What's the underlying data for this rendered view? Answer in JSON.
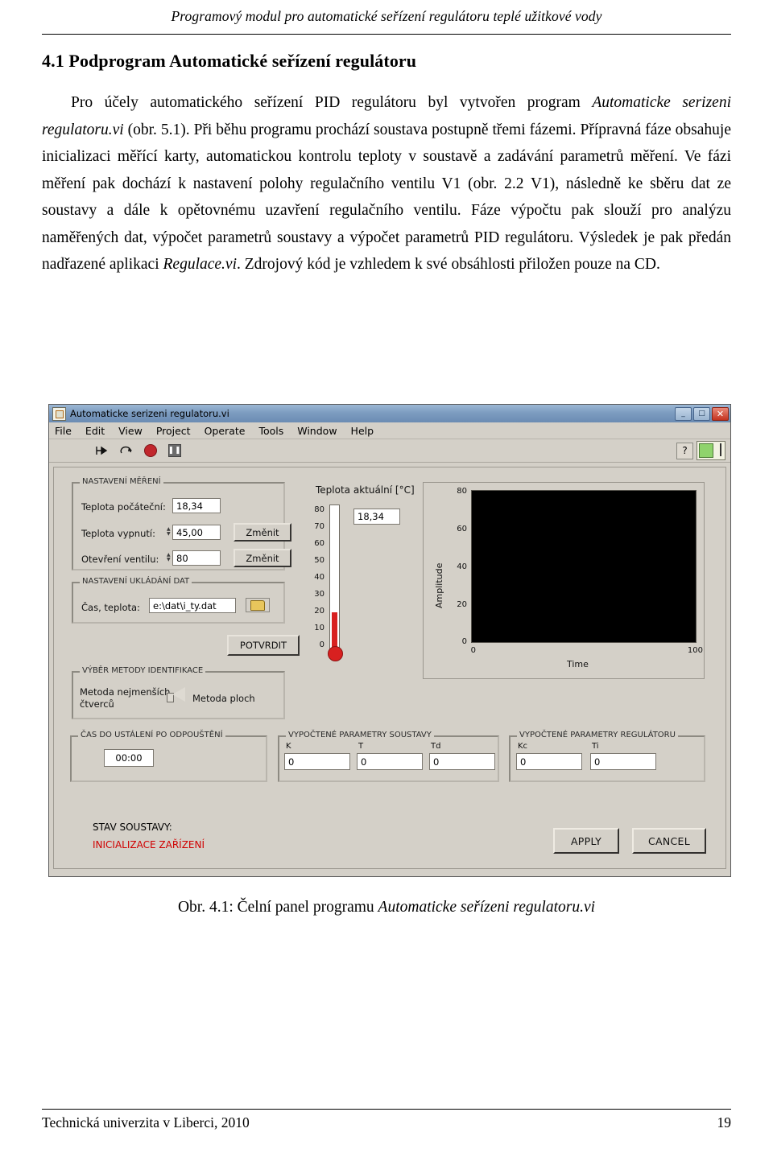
{
  "header": {
    "running_head": "Programový modul pro automatické seřízení regulátoru teplé užitkové vody"
  },
  "footer": {
    "left": "Technická univerzita v Liberci, 2010",
    "page_number": "19"
  },
  "section": {
    "title": "4.1 Podprogram Automatické seřízení regulátoru",
    "paragraph": {
      "p1": "Pro účely automatického seřízení PID regulátoru byl vytvořen program ",
      "i1": "Automaticke serizeni regulatoru.vi",
      "p2": " (obr. 5.1). Při běhu programu prochází soustava postupně třemi fázemi. Přípravná fáze obsahuje inicializaci měřící karty, automatickou kontrolu teploty v soustavě a zadávání parametrů měření. Ve fázi měření pak dochází k nastavení polohy regulačního ventilu V1 (obr. 2.2 V1), následně ke sběru dat ze soustavy a dále k opětovnému uzavření regulačního ventilu. Fáze výpočtu pak slouží pro analýzu naměřených dat, výpočet parametrů soustavy a výpočet parametrů PID regulátoru. Výsledek je pak předán nadřazené aplikaci ",
      "i2": "Regulace.vi",
      "p3": ". Zdrojový kód je vzhledem k své obsáhlosti přiložen pouze na CD."
    }
  },
  "figure": {
    "caption_prefix": "Obr. 4.1: Čelní panel programu ",
    "caption_italic": "Automaticke seřízeni regulatoru.vi"
  },
  "vi": {
    "title": "Automaticke serizeni regulatoru.vi",
    "window_buttons": {
      "minimize": "_",
      "maximize": "□",
      "close": "✕"
    },
    "menu": [
      "File",
      "Edit",
      "View",
      "Project",
      "Operate",
      "Tools",
      "Window",
      "Help"
    ],
    "toolbar": {
      "run_icon": "run-arrow-icon",
      "run_continuous_icon": "run-continuous-icon",
      "abort_icon": "abort-button-icon",
      "pause_icon": "pause-button-icon",
      "help_icon": "?",
      "pause_glyph": "❚❚"
    },
    "measurement_group": {
      "label": "NASTAVENÍ MĚŘENÍ",
      "rows": [
        {
          "label": "Teplota počáteční:",
          "value": "18,34",
          "button": null
        },
        {
          "label": "Teplota vypnutí:",
          "value": "45,00",
          "button": "Změnit"
        },
        {
          "label": "Otevření ventilu:",
          "value": "80",
          "button": "Změnit"
        }
      ]
    },
    "storage_group": {
      "label": "NASTAVENÍ UKLÁDÁNÍ DAT",
      "row_label": "Čas, teplota:",
      "path_value": "e:\\dat\\i_ty.dat",
      "folder_icon": "folder-icon"
    },
    "confirm_button": "POTVRDIT",
    "method_group": {
      "label": "VÝBĚR METODY IDENTIFIKACE",
      "option_left_line1": "Metoda nejmenších",
      "option_left_line2": "čtverců",
      "option_right": "Metoda ploch"
    },
    "thermometer": {
      "title": "Teplota aktuální [°C]",
      "digital_value": "18,34",
      "ticks": [
        "80",
        "70",
        "60",
        "50",
        "40",
        "30",
        "20",
        "10",
        "0"
      ]
    },
    "graph": {
      "ylabel": "Amplitude",
      "xlabel": "Time",
      "y_ticks": [
        "80",
        "60",
        "40",
        "20",
        "0"
      ],
      "x_ticks": [
        "0",
        "100"
      ]
    },
    "settle_group": {
      "label": "ČAS DO USTÁLENÍ PO ODPOUŠTĚNÍ",
      "value": "00:00"
    },
    "system_params_group": {
      "label": "VYPOČTENÉ PARAMETRY SOUSTAVY",
      "fields": [
        {
          "label": "K",
          "value": "0"
        },
        {
          "label": "T",
          "value": "0"
        },
        {
          "label": "Td",
          "value": "0"
        }
      ]
    },
    "controller_params_group": {
      "label": "VYPOČTENÉ PARAMETRY REGULÁTORU",
      "fields": [
        {
          "label": "Kc",
          "value": "0"
        },
        {
          "label": "Ti",
          "value": "0"
        }
      ]
    },
    "status": {
      "label": "STAV SOUSTAVY:",
      "value": "INICIALIZACE ZAŘÍZENÍ",
      "value_color": "#d00000"
    },
    "apply_button": "APPLY",
    "cancel_button": "CANCEL"
  }
}
